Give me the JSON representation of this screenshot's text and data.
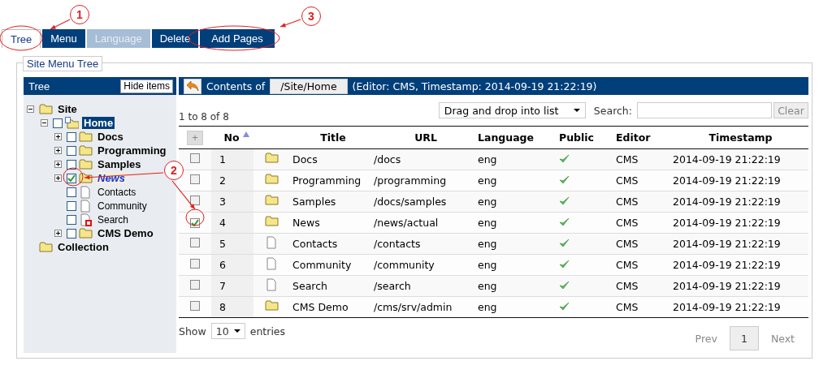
{
  "tabs": [
    {
      "label": "Tree",
      "selected": true,
      "disabled": false
    },
    {
      "label": "Menu",
      "selected": false,
      "disabled": false
    },
    {
      "label": "Language",
      "selected": false,
      "disabled": true
    },
    {
      "label": "Delete",
      "selected": false,
      "disabled": false
    },
    {
      "label": "Add Pages",
      "selected": false,
      "disabled": false
    }
  ],
  "group_title": "Site Menu Tree",
  "tree": {
    "title": "Tree",
    "hide_button": "Hide items",
    "items": [
      {
        "label": "Site",
        "kind": "folder",
        "expanded": true,
        "selected": false,
        "highlighted": false,
        "children": [
          {
            "label": "Home",
            "kind": "home",
            "expanded": true,
            "checked": false,
            "selected": true,
            "highlighted": false,
            "children": [
              {
                "label": "Docs",
                "kind": "folder",
                "expanded": false,
                "checked": false,
                "selected": false,
                "highlighted": false
              },
              {
                "label": "Programming",
                "kind": "folder",
                "expanded": false,
                "checked": false,
                "selected": false,
                "highlighted": false
              },
              {
                "label": "Samples",
                "kind": "folder",
                "expanded": false,
                "checked": false,
                "selected": false,
                "highlighted": false
              },
              {
                "label": "News",
                "kind": "folder",
                "expanded": false,
                "checked": true,
                "selected": false,
                "highlighted": true
              },
              {
                "label": "Contacts",
                "kind": "page",
                "checked": false,
                "selected": false,
                "highlighted": false
              },
              {
                "label": "Community",
                "kind": "page",
                "checked": false,
                "selected": false,
                "highlighted": false
              },
              {
                "label": "Search",
                "kind": "page-marked",
                "checked": false,
                "selected": false,
                "highlighted": false
              },
              {
                "label": "CMS Demo",
                "kind": "folder",
                "expanded": false,
                "checked": false,
                "selected": false,
                "highlighted": false
              }
            ]
          }
        ]
      },
      {
        "label": "Collection",
        "kind": "folder",
        "selected": false,
        "highlighted": false
      }
    ]
  },
  "contents": {
    "prefix": "Contents of",
    "path": "/Site/Home",
    "info": "(Editor: CMS, Timestamp: 2014-09-19 21:22:19)",
    "count": "1 to 8 of 8",
    "mode_select": "Drag and drop into list",
    "search_label": "Search:",
    "clear_button": "Clear",
    "add_button": "+",
    "columns": [
      {
        "label": "No",
        "sorted": true
      },
      {
        "label": "Title",
        "sorted": false
      },
      {
        "label": "URL",
        "sorted": false
      },
      {
        "label": "Language",
        "sorted": false
      },
      {
        "label": "Public",
        "sorted": false
      },
      {
        "label": "Editor",
        "sorted": false
      },
      {
        "label": "Timestamp",
        "sorted": false
      }
    ],
    "rows": [
      {
        "checked": false,
        "no": "1",
        "kind": "folder",
        "title": "Docs",
        "url": "/docs",
        "language": "eng",
        "public": true,
        "editor": "CMS",
        "timestamp": "2014-09-19 21:22:19"
      },
      {
        "checked": false,
        "no": "2",
        "kind": "folder",
        "title": "Programming",
        "url": "/programming",
        "language": "eng",
        "public": true,
        "editor": "CMS",
        "timestamp": "2014-09-19 21:22:19"
      },
      {
        "checked": false,
        "no": "3",
        "kind": "folder",
        "title": "Samples",
        "url": "/docs/samples",
        "language": "eng",
        "public": true,
        "editor": "CMS",
        "timestamp": "2014-09-19 21:22:19"
      },
      {
        "checked": true,
        "no": "4",
        "kind": "folder",
        "title": "News",
        "url": "/news/actual",
        "language": "eng",
        "public": true,
        "editor": "CMS",
        "timestamp": "2014-09-19 21:22:19"
      },
      {
        "checked": false,
        "no": "5",
        "kind": "page",
        "title": "Contacts",
        "url": "/contacts",
        "language": "eng",
        "public": true,
        "editor": "CMS",
        "timestamp": "2014-09-19 21:22:19"
      },
      {
        "checked": false,
        "no": "6",
        "kind": "page",
        "title": "Community",
        "url": "/community",
        "language": "eng",
        "public": true,
        "editor": "CMS",
        "timestamp": "2014-09-19 21:22:19"
      },
      {
        "checked": false,
        "no": "7",
        "kind": "page",
        "title": "Search",
        "url": "/search",
        "language": "eng",
        "public": true,
        "editor": "CMS",
        "timestamp": "2014-09-19 21:22:19"
      },
      {
        "checked": false,
        "no": "8",
        "kind": "folder",
        "title": "CMS Demo",
        "url": "/cms/srv/admin",
        "language": "eng",
        "public": true,
        "editor": "CMS",
        "timestamp": "2014-09-19 21:22:19"
      }
    ],
    "show_label": "Show",
    "page_size": "10",
    "entries_label": "entries",
    "pagination": {
      "prev": {
        "label": "Prev",
        "disabled": true
      },
      "pages": [
        {
          "label": "1",
          "selected": true
        }
      ],
      "next": {
        "label": "Next",
        "disabled": true
      }
    }
  },
  "callouts": [
    {
      "label": "1"
    },
    {
      "label": "2"
    },
    {
      "label": "3"
    }
  ]
}
